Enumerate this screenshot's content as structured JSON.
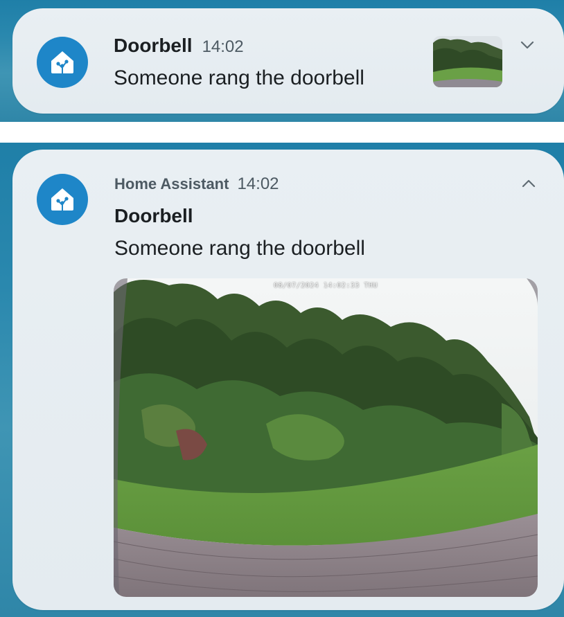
{
  "colors": {
    "backdrop": "#2a88ae",
    "card": "#e7edf1",
    "app_icon": "#1e86c8",
    "title_text": "#1b1f22",
    "secondary_text": "#4d5a63"
  },
  "collapsed_notification": {
    "title": "Doorbell",
    "time": "14:02",
    "body": "Someone rang the doorbell",
    "app_icon": "home-assistant-icon",
    "thumbnail": "doorbell-camera-snapshot",
    "expand_icon": "chevron-down-icon"
  },
  "expanded_notification": {
    "app_name": "Home Assistant",
    "time": "14:02",
    "title": "Doorbell",
    "body": "Someone rang the doorbell",
    "app_icon": "home-assistant-icon",
    "collapse_icon": "chevron-up-icon",
    "image": {
      "subject": "doorbell-camera-snapshot",
      "timestamp_overlay": "08/07/2024 14:02:33 THU"
    }
  }
}
